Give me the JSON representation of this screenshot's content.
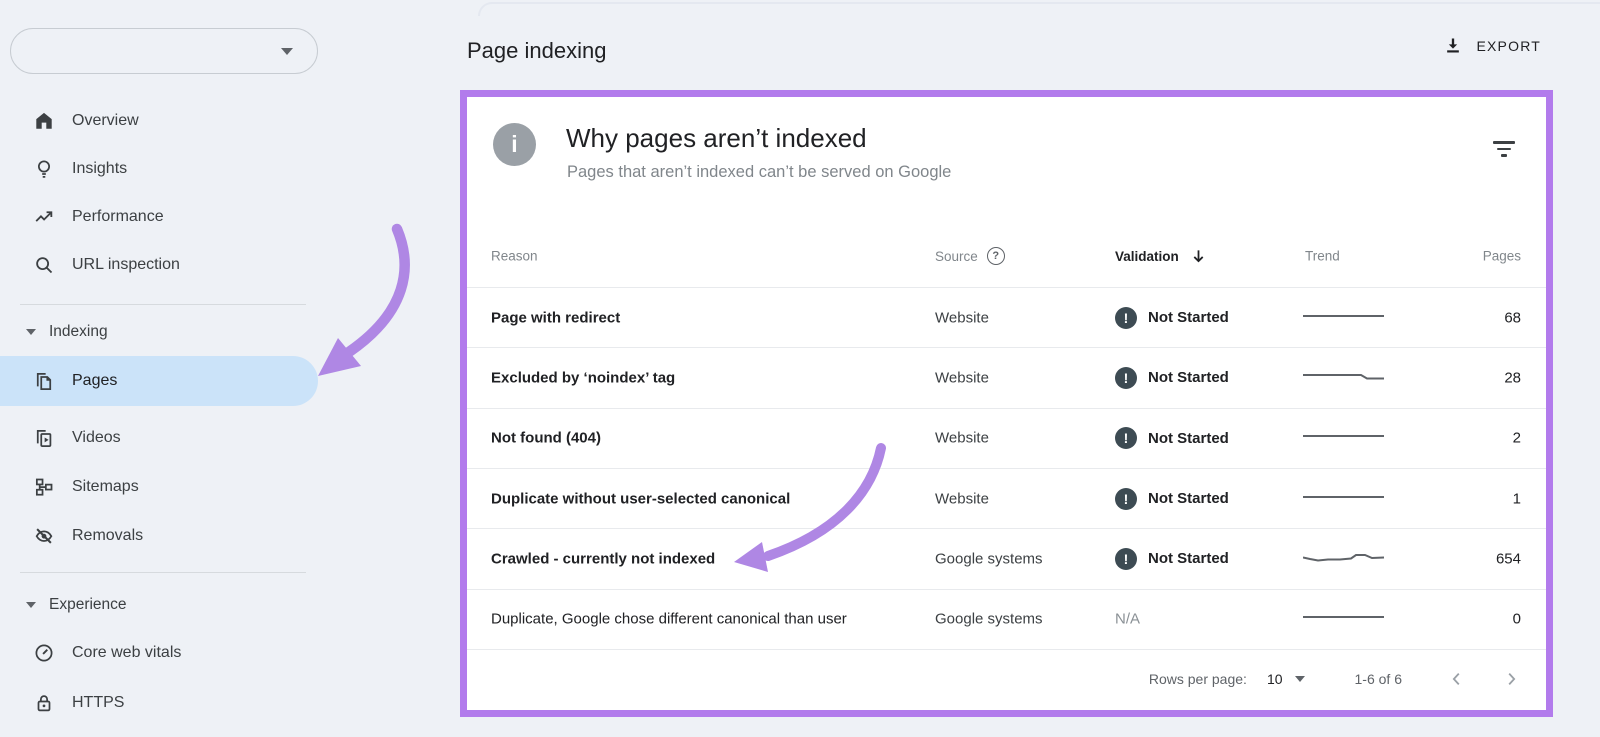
{
  "sidebar": {
    "property_selector": {
      "value": "",
      "icon": "chevron-down-icon"
    },
    "items": [
      {
        "label": "Overview",
        "icon": "home-icon"
      },
      {
        "label": "Insights",
        "icon": "lightbulb-icon"
      },
      {
        "label": "Performance",
        "icon": "trending-up-icon"
      },
      {
        "label": "URL inspection",
        "icon": "search-icon"
      }
    ],
    "sections": [
      {
        "label": "Indexing",
        "items": [
          {
            "label": "Pages",
            "icon": "pages-icon",
            "selected": true
          },
          {
            "label": "Videos",
            "icon": "videos-icon"
          },
          {
            "label": "Sitemaps",
            "icon": "sitemap-icon"
          },
          {
            "label": "Removals",
            "icon": "eye-off-icon"
          }
        ]
      },
      {
        "label": "Experience",
        "items": [
          {
            "label": "Core web vitals",
            "icon": "speedometer-icon"
          },
          {
            "label": "HTTPS",
            "icon": "lock-icon"
          }
        ]
      }
    ]
  },
  "header": {
    "title": "Page indexing",
    "export_label": "EXPORT"
  },
  "card": {
    "title": "Why pages aren’t indexed",
    "subtitle": "Pages that aren’t indexed can’t be served on Google",
    "columns": {
      "reason": "Reason",
      "source": "Source",
      "validation": "Validation",
      "trend": "Trend",
      "pages": "Pages"
    },
    "rows": [
      {
        "reason": "Page with redirect",
        "source": "Website",
        "validation": "Not Started",
        "validation_state": "not_started",
        "trend": "flat",
        "pages": "68",
        "emphasis": true
      },
      {
        "reason": "Excluded by ‘noindex’ tag",
        "source": "Website",
        "validation": "Not Started",
        "validation_state": "not_started",
        "trend": "step_down",
        "pages": "28",
        "emphasis": true
      },
      {
        "reason": "Not found (404)",
        "source": "Website",
        "validation": "Not Started",
        "validation_state": "not_started",
        "trend": "flat",
        "pages": "2",
        "emphasis": true
      },
      {
        "reason": "Duplicate without user-selected canonical",
        "source": "Website",
        "validation": "Not Started",
        "validation_state": "not_started",
        "trend": "flat",
        "pages": "1",
        "emphasis": true
      },
      {
        "reason": "Crawled - currently not indexed",
        "source": "Google systems",
        "validation": "Not Started",
        "validation_state": "not_started",
        "trend": "wavy",
        "pages": "654",
        "emphasis": true
      },
      {
        "reason": "Duplicate, Google chose different canonical than user",
        "source": "Google systems",
        "validation": "N/A",
        "validation_state": "na",
        "trend": "flat",
        "pages": "0",
        "emphasis": false
      }
    ],
    "pagination": {
      "rows_per_page_label": "Rows per page:",
      "rows_per_page_value": "10",
      "range_label": "1-6 of 6"
    }
  },
  "colors": {
    "accent_purple_border": "#b27bec",
    "accent_purple_arrow": "#af87e4",
    "selected_item_blue": "#cbe3f9",
    "badge_dark": "#3d4b53",
    "background": "#eef1f6"
  }
}
